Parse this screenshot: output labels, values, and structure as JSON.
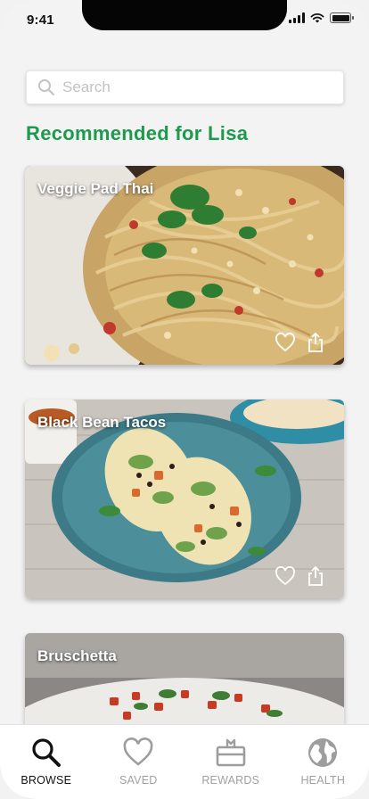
{
  "status_bar": {
    "time": "9:41"
  },
  "search": {
    "placeholder": "Search",
    "value": ""
  },
  "section": {
    "title": "Recommended for Lisa"
  },
  "cards": [
    {
      "title": "Veggie Pad Thai"
    },
    {
      "title": "Black Bean Tacos"
    },
    {
      "title": "Bruschetta"
    }
  ],
  "tabs": [
    {
      "label": "BROWSE",
      "icon": "search-icon",
      "active": true
    },
    {
      "label": "SAVED",
      "icon": "heart-icon",
      "active": false
    },
    {
      "label": "REWARDS",
      "icon": "gift-icon",
      "active": false
    },
    {
      "label": "HEALTH",
      "icon": "globe-icon",
      "active": false
    }
  ],
  "colors": {
    "accent": "#1e9a4e",
    "inactive": "#a0a0a0"
  }
}
